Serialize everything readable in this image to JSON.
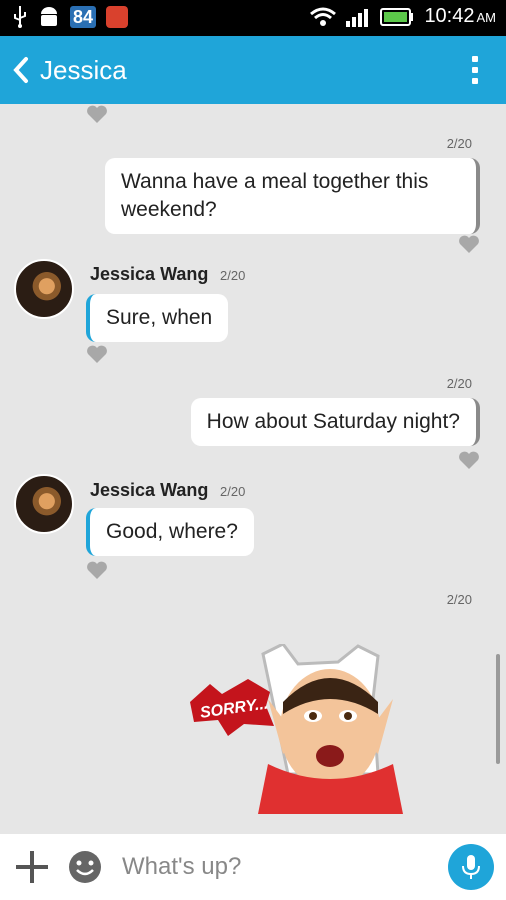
{
  "status_bar": {
    "battery_badge": "84",
    "time": "10:42",
    "ampm": "AM"
  },
  "header": {
    "title": "Jessica"
  },
  "messages": [
    {
      "direction": "out",
      "timestamp": "2/20",
      "text": "Wanna have a meal together this weekend?"
    },
    {
      "direction": "in",
      "sender": "Jessica Wang",
      "timestamp": "2/20",
      "text": "Sure, when"
    },
    {
      "direction": "out",
      "timestamp": "2/20",
      "text": "How about Saturday night?"
    },
    {
      "direction": "in",
      "sender": "Jessica Wang",
      "timestamp": "2/20",
      "text": "Good, where?"
    },
    {
      "direction": "out",
      "timestamp": "2/20",
      "sticker": "sorry-sticker",
      "sticker_text": "SORRY..."
    }
  ],
  "composer": {
    "placeholder": "What's up?"
  },
  "colors": {
    "accent": "#1fa5d9",
    "status_bar": "#000000",
    "chat_bg": "#e6e6e6"
  },
  "icons": [
    "usb-icon",
    "android-icon",
    "app-icon",
    "wifi-icon",
    "signal-icon",
    "battery-icon",
    "back-icon",
    "overflow-menu-icon",
    "heart-icon",
    "plus-icon",
    "emoji-icon",
    "mic-icon"
  ]
}
